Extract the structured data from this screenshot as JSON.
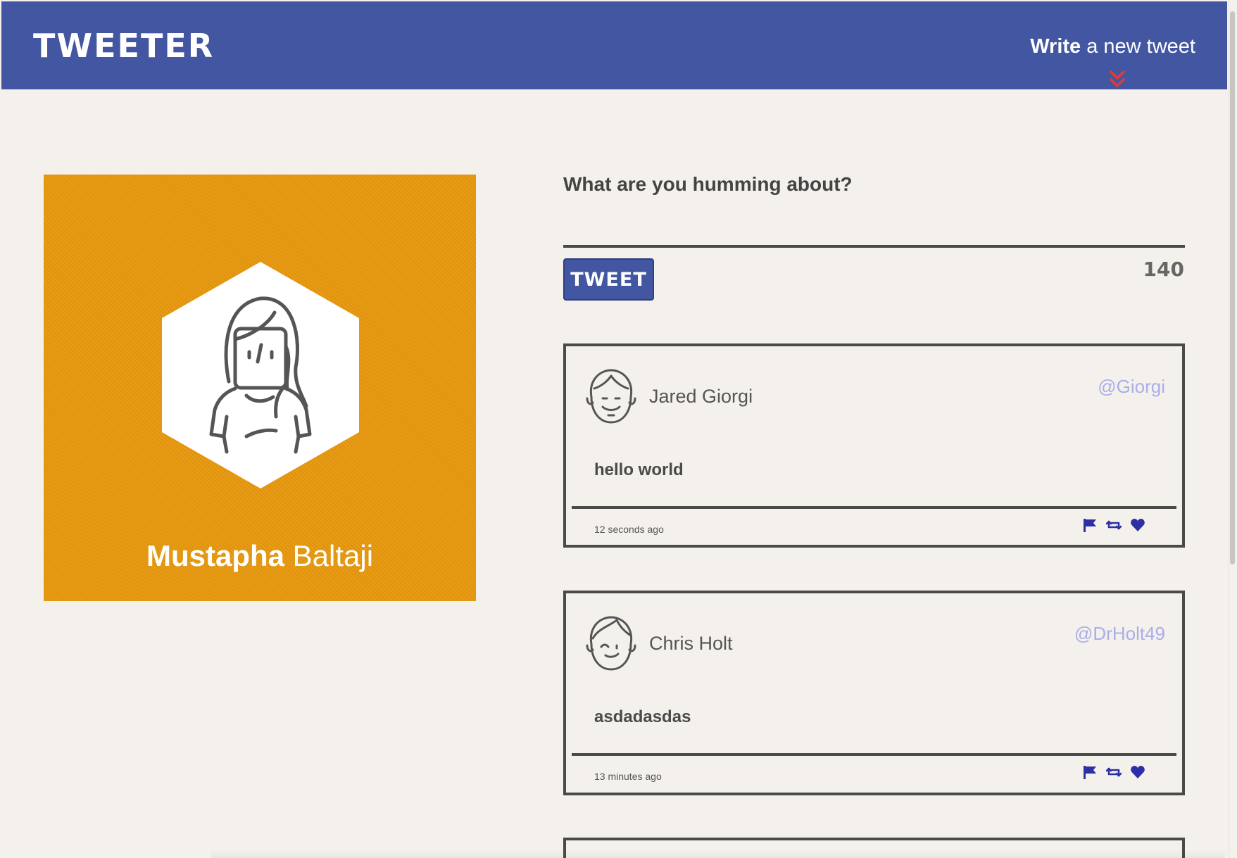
{
  "nav": {
    "brand": "TWEETER",
    "compose_bold": "Write",
    "compose_rest": " a new tweet",
    "chevron_icon": "double-chevron-down-icon",
    "chevron_color": "#e53935",
    "bar_color": "#4356a2"
  },
  "profile": {
    "first_name": "Mustapha",
    "last_name": "Baltaji",
    "avatar_icon": "user-female-avatar-icon",
    "background_color": "#e8990e"
  },
  "composer": {
    "prompt": "What are you humming about?",
    "button_label": "TWEET",
    "counter": "140"
  },
  "tweets": [
    {
      "name": "Jared Giorgi",
      "handle": "@Giorgi",
      "text": "hello world",
      "time": "12 seconds ago",
      "avatar_icon": "male-avatar-icon"
    },
    {
      "name": "Chris Holt",
      "handle": "@DrHolt49",
      "text": "asdadasdas",
      "time": "13 minutes ago",
      "avatar_icon": "male-avatar-winking-icon"
    }
  ],
  "actions": {
    "flag_icon": "flag-icon",
    "retweet_icon": "retweet-icon",
    "like_icon": "heart-icon",
    "action_color": "#2c2fa6"
  }
}
